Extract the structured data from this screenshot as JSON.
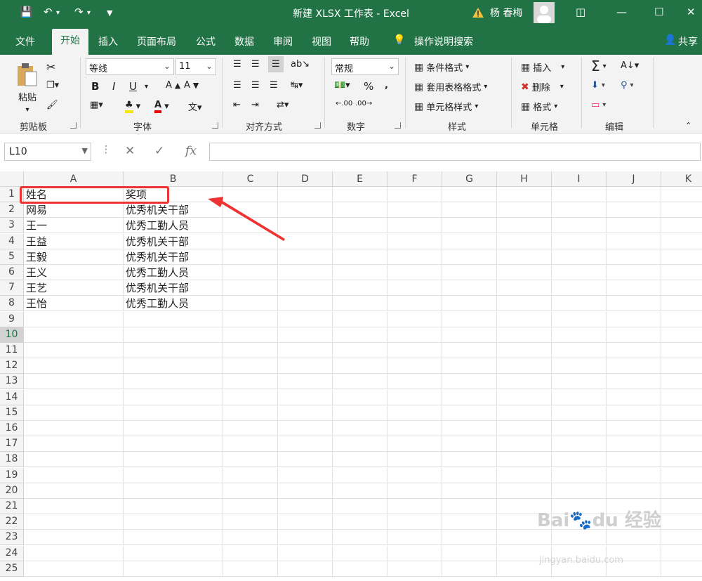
{
  "titlebar": {
    "title": "新建 XLSX 工作表 - Excel",
    "user": "杨 春梅",
    "colors": {
      "brand": "#217346"
    }
  },
  "tabs": [
    {
      "label": "文件"
    },
    {
      "label": "开始",
      "active": true
    },
    {
      "label": "插入"
    },
    {
      "label": "页面布局"
    },
    {
      "label": "公式"
    },
    {
      "label": "数据"
    },
    {
      "label": "审阅"
    },
    {
      "label": "视图"
    },
    {
      "label": "帮助"
    },
    {
      "label": "操作说明搜索"
    },
    {
      "label": "共享"
    }
  ],
  "ribbon": {
    "clipboard": {
      "paste": "粘贴",
      "group": "剪贴板"
    },
    "font": {
      "name": "等线",
      "size": "11",
      "group": "字体",
      "bold": "B",
      "italic": "I",
      "underline": "U"
    },
    "align": {
      "group": "对齐方式"
    },
    "number": {
      "format": "常规",
      "group": "数字",
      "percent": "%"
    },
    "styles": {
      "conditional": "条件格式",
      "table": "套用表格格式",
      "cell": "单元格样式",
      "group": "样式"
    },
    "cells": {
      "insert": "插入",
      "delete": "删除",
      "format": "格式",
      "group": "单元格"
    },
    "edit": {
      "group": "编辑"
    }
  },
  "formula_bar": {
    "name_box": "L10",
    "formula": ""
  },
  "columns": [
    "A",
    "B",
    "C",
    "D",
    "E",
    "F",
    "G",
    "H",
    "I",
    "J",
    "K"
  ],
  "rows": [
    "1",
    "2",
    "3",
    "4",
    "5",
    "6",
    "7",
    "8",
    "9",
    "10",
    "11",
    "12",
    "13",
    "14",
    "15",
    "16",
    "17",
    "18",
    "19",
    "20",
    "21",
    "22",
    "23",
    "24",
    "25"
  ],
  "selected_row": "10",
  "cells": [
    [
      "姓名",
      "奖项"
    ],
    [
      "网易",
      "优秀机关干部"
    ],
    [
      "王一",
      "优秀工勤人员"
    ],
    [
      "王益",
      "优秀机关干部"
    ],
    [
      "王毅",
      "优秀机关干部"
    ],
    [
      "王义",
      "优秀工勤人员"
    ],
    [
      "王艺",
      "优秀机关干部"
    ],
    [
      "王怡",
      "优秀工勤人员"
    ]
  ],
  "watermark": {
    "main": "Bai 经验",
    "sub": "jingyan.baidu.com"
  }
}
